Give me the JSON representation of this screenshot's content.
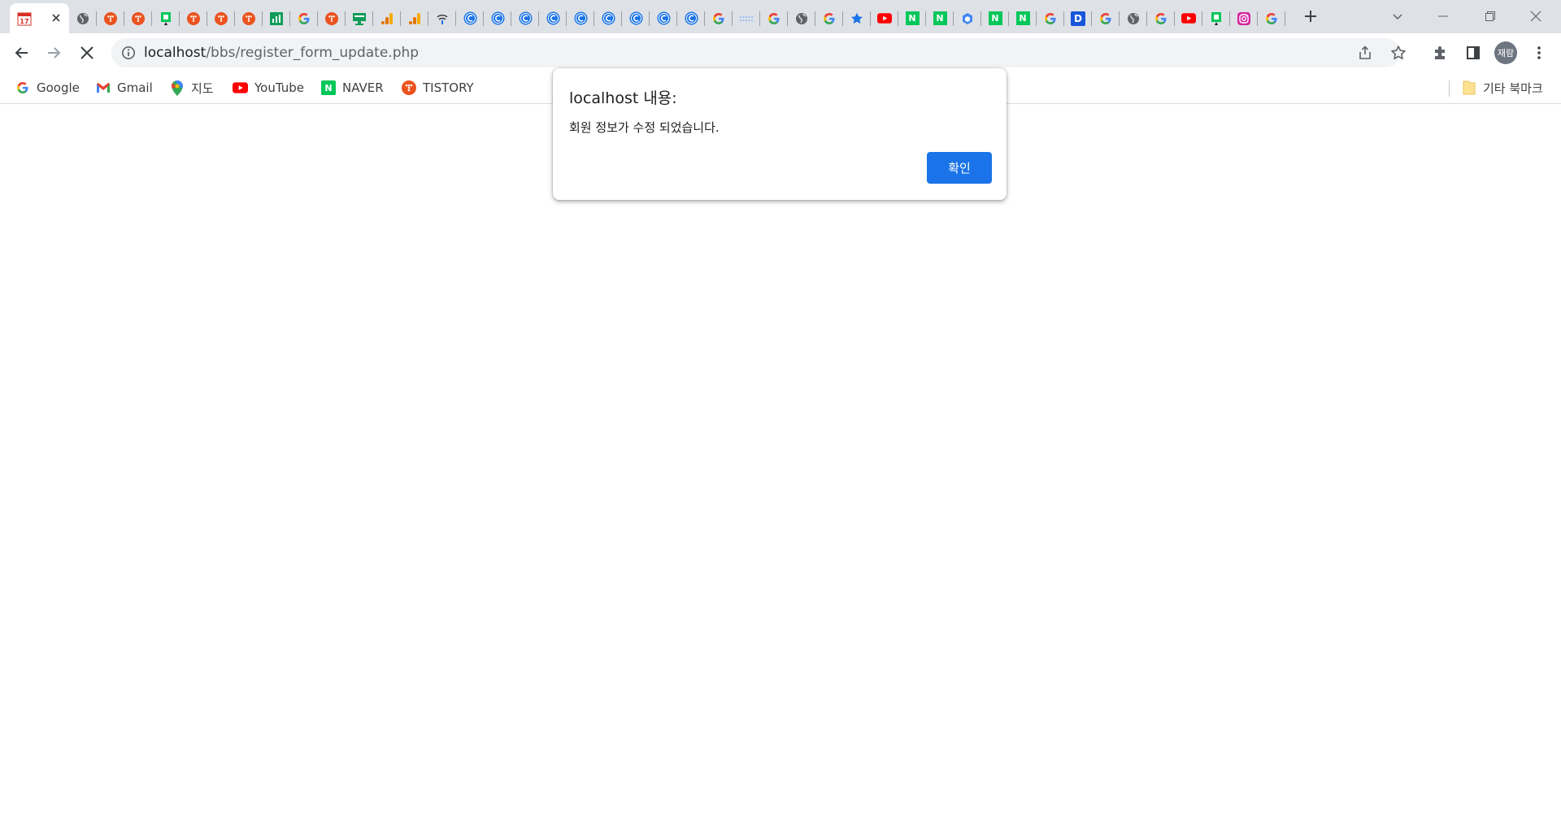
{
  "browser": {
    "tabs": [
      {
        "icon": "calendar-icon"
      },
      {
        "icon": "globe-icon"
      },
      {
        "icon": "tistory-icon"
      },
      {
        "icon": "tistory-icon"
      },
      {
        "icon": "naver-map-icon"
      },
      {
        "icon": "tistory-icon"
      },
      {
        "icon": "tistory-icon"
      },
      {
        "icon": "tistory-icon"
      },
      {
        "icon": "sheets-icon"
      },
      {
        "icon": "google-icon"
      },
      {
        "icon": "tistory-icon"
      },
      {
        "icon": "monitor-icon"
      },
      {
        "icon": "analytics-icon"
      },
      {
        "icon": "analytics-icon"
      },
      {
        "icon": "wifi-icon"
      },
      {
        "icon": "c-circle-icon"
      },
      {
        "icon": "c-circle-icon"
      },
      {
        "icon": "c-circle-icon"
      },
      {
        "icon": "c-circle-icon"
      },
      {
        "icon": "c-circle-icon"
      },
      {
        "icon": "c-circle-icon"
      },
      {
        "icon": "c-circle-icon"
      },
      {
        "icon": "c-circle-icon"
      },
      {
        "icon": "c-circle-icon"
      },
      {
        "icon": "google-icon"
      },
      {
        "icon": "dotted-icon"
      },
      {
        "icon": "google-icon"
      },
      {
        "icon": "globe-icon"
      },
      {
        "icon": "google-icon"
      },
      {
        "icon": "star-icon"
      },
      {
        "icon": "youtube-icon"
      },
      {
        "icon": "naver-icon"
      },
      {
        "icon": "naver-icon"
      },
      {
        "icon": "hexagon-icon"
      },
      {
        "icon": "naver-icon"
      },
      {
        "icon": "naver-icon"
      },
      {
        "icon": "google-icon"
      },
      {
        "icon": "d-icon"
      },
      {
        "icon": "google-icon"
      },
      {
        "icon": "globe-icon"
      },
      {
        "icon": "google-icon"
      },
      {
        "icon": "youtube-icon"
      },
      {
        "icon": "naver-map-icon"
      },
      {
        "icon": "instagram-icon"
      },
      {
        "icon": "google-icon"
      }
    ],
    "active_tab_index": 0,
    "address": {
      "host": "localhost",
      "path": "/bbs/register_form_update.php"
    },
    "profile_initials": "재람",
    "bookmarks": [
      {
        "label": "Google",
        "icon": "google-icon"
      },
      {
        "label": "Gmail",
        "icon": "gmail-icon"
      },
      {
        "label": "지도",
        "icon": "maps-pin-icon"
      },
      {
        "label": "YouTube",
        "icon": "youtube-icon"
      },
      {
        "label": "NAVER",
        "icon": "naver-icon"
      },
      {
        "label": "TISTORY",
        "icon": "tistory-icon"
      }
    ],
    "other_bookmarks_label": "기타 북마크"
  },
  "dialog": {
    "title": "localhost 내용:",
    "message": "회원 정보가 수정 되었습니다.",
    "ok_label": "확인"
  },
  "colors": {
    "accent": "#1a73e8",
    "tabstrip": "#dee1e6",
    "omnibox": "#f1f3f4"
  }
}
